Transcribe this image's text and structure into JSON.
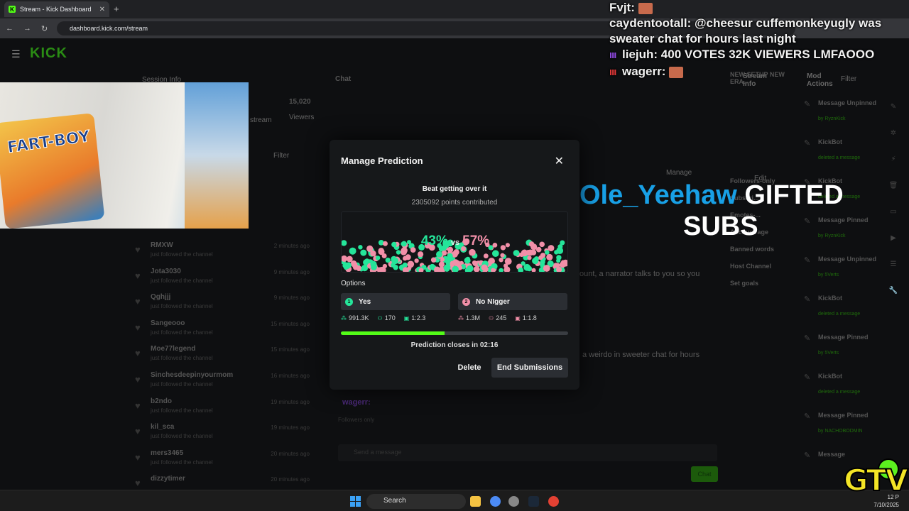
{
  "browser": {
    "tab_title": "Stream - Kick Dashboard",
    "favicon_letter": "K",
    "url": "dashboard.kick.com/stream"
  },
  "dashboard": {
    "logo": "KICK",
    "session_info": "Session Info",
    "viewers_count": "15,020",
    "viewers_label": "Viewers",
    "stream_label": "stream",
    "filter_label": "Filter",
    "chat_label": "Chat",
    "stream_info_label": "Stream Info",
    "mod_actions_label": "Mod Actions",
    "mod_filter_label": "Filter",
    "activity": [
      {
        "name": "RMXW",
        "sub": "just followed the channel",
        "time": "2 minutes ago"
      },
      {
        "name": "Jota3030",
        "sub": "just followed the channel",
        "time": "9 minutes ago"
      },
      {
        "name": "Qghjjj",
        "sub": "just followed the channel",
        "time": "9 minutes ago"
      },
      {
        "name": "Sangeooo",
        "sub": "just followed the channel",
        "time": "15 minutes ago"
      },
      {
        "name": "Moe77legend",
        "sub": "just followed the channel",
        "time": "15 minutes ago"
      },
      {
        "name": "Sinchesdeepinyourmom",
        "sub": "just followed the channel",
        "time": "16 minutes ago"
      },
      {
        "name": "b2ndo",
        "sub": "just followed the channel",
        "time": "19 minutes ago"
      },
      {
        "name": "kil_sca",
        "sub": "just followed the channel",
        "time": "19 minutes ago"
      },
      {
        "name": "mers3465",
        "sub": "just followed the channel",
        "time": "20 minutes ago"
      },
      {
        "name": "dizzytimer",
        "sub": "",
        "time": "20 minutes ago"
      }
    ],
    "stream_settings": [
      "NEW SETUP NEW ERA...",
      "Followers-only",
      "Subscri...",
      "Emotes-...",
      "Account age",
      "Banned words",
      "Host Channel",
      "Set goals"
    ],
    "mod_log": [
      {
        "title": "Message Unpinned",
        "by": "by RyznKick"
      },
      {
        "title": "KickBot",
        "by": "deleted a message"
      },
      {
        "title": "KickBot",
        "by": "deleted a message"
      },
      {
        "title": "Message Pinned",
        "by": "by RyznKick"
      },
      {
        "title": "Message Unpinned",
        "by": "by 5Verts"
      },
      {
        "title": "KickBot",
        "by": "deleted a message"
      },
      {
        "title": "Message Pinned",
        "by": "by 5Verts"
      },
      {
        "title": "KickBot",
        "by": "deleted a message"
      },
      {
        "title": "Message Pinned",
        "by": "by NACHOBODMIN"
      },
      {
        "title": "Message",
        "by": ""
      }
    ],
    "chat_input_placeholder": "Send a message",
    "chat_button": "Chat",
    "chat_behind_1": "ount, a narrator talks to you so you",
    "chat_behind_2": "a weirdo in sweeter chat for hours",
    "manage_label": "Manage",
    "edit_label": "Edit",
    "wager_name": "wagerr:",
    "followers_only_note": "Followers only"
  },
  "webcam": {
    "shirt_text": "FART-BOY"
  },
  "overlay_chat": [
    {
      "user": "Fvjt:",
      "text": "",
      "badge": ""
    },
    {
      "user": "caydentootall:",
      "text": "@cheesur cuffemonkeyugly was",
      "badge": ""
    },
    {
      "user": "",
      "text": "sweater chat for hours last night",
      "badge": ""
    },
    {
      "user": "liejuh:",
      "text": "400 VOTES 32K VIEWERS LMFAOOO",
      "badge": "purple"
    },
    {
      "user": "wagerr:",
      "text": "",
      "badge": "red"
    }
  ],
  "gift_alert": {
    "user": "Ole_Yeehaw",
    "text": "GIFTED",
    "subs": "SUBS"
  },
  "prediction": {
    "modal_title": "Manage Prediction",
    "question": "Beat getting over it",
    "points_contributed": "2305092 points contributed",
    "percent_a": "43%",
    "vs": "vs",
    "percent_b": "57%",
    "options_label": "Options",
    "options": [
      {
        "num": "1",
        "label": "Yes",
        "points": "991.3K",
        "users": "170",
        "ratio": "1:2.3",
        "color": "#25e59a"
      },
      {
        "num": "2",
        "label": "No NIgger",
        "points": "1.3M",
        "users": "245",
        "ratio": "1:1.8",
        "color": "#f18fa8"
      }
    ],
    "progress_fraction": 0.455,
    "closes_label": "Prediction closes in",
    "closes_time": "02:16",
    "delete_button": "Delete",
    "end_button": "End Submissions"
  },
  "taskbar": {
    "search_label": "Search",
    "clock_time": "12 P",
    "clock_date": "7/10/2025"
  },
  "watermark": "GTV",
  "colors": {
    "kick_green": "#53fc18",
    "yes_green": "#25e59a",
    "no_pink": "#f18fa8",
    "gift_blue": "#18a0e6"
  }
}
